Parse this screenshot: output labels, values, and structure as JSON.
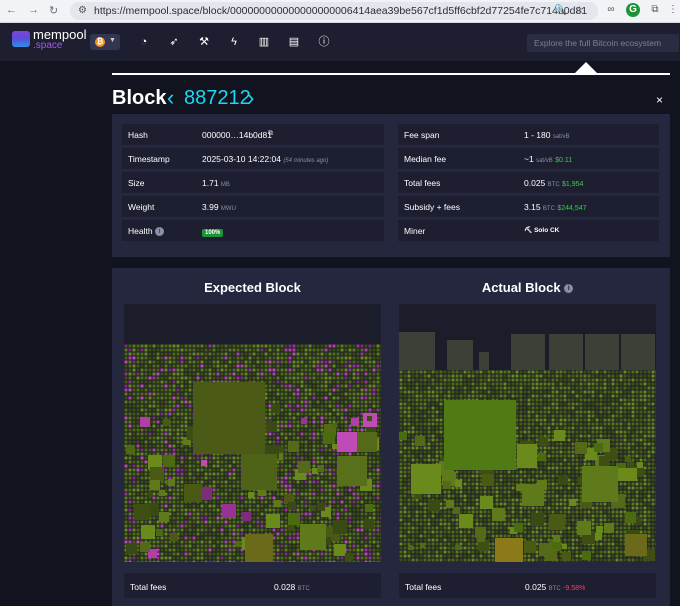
{
  "browser": {
    "url": "https://mempool.space/block/000000000000000000006414aea39be567cf1d5ff6cbf2d77254fe7c714b0d81"
  },
  "nav": {
    "logo_line1": "mempool",
    "logo_line2": ".space",
    "search_placeholder": "Explore the full Bitcoin ecosystem",
    "icons": [
      "dashboard-icon",
      "rocket-icon",
      "hammer-icon",
      "lightning-icon",
      "chart-icon",
      "docs-icon",
      "info-icon"
    ]
  },
  "page": {
    "title_word": "Block",
    "block_height": "887212",
    "close": "×"
  },
  "details_left": [
    {
      "label": "Hash",
      "value": "000000…14b0d81",
      "unit": ""
    },
    {
      "label": "Timestamp",
      "value": "2025-03-10 14:22:04",
      "unit": "(54 minutes ago)"
    },
    {
      "label": "Size",
      "value": "1.71",
      "unit": "MB"
    },
    {
      "label": "Weight",
      "value": "3.99",
      "unit": "MWU"
    },
    {
      "label": "Health",
      "value": "100%",
      "unit": ""
    }
  ],
  "details_right": [
    {
      "label": "Fee span",
      "value": "1 - 180",
      "unit": "sat/vB",
      "fiat": ""
    },
    {
      "label": "Median fee",
      "value": "~1",
      "unit": "sat/vB",
      "fiat": "$0.11"
    },
    {
      "label": "Total fees",
      "value": "0.025",
      "unit": "BTC",
      "fiat": "$1,954"
    },
    {
      "label": "Subsidy + fees",
      "value": "3.15",
      "unit": "BTC",
      "fiat": "$244,547"
    },
    {
      "label": "Miner",
      "value": "Solo CK",
      "unit": "",
      "fiat": ""
    }
  ],
  "expected": {
    "title": "Expected Block",
    "fees_label": "Total fees",
    "fees_value": "0.028",
    "fees_unit": "BTC"
  },
  "actual": {
    "title": "Actual Block",
    "fees_label": "Total fees",
    "fees_value": "0.025",
    "fees_unit": "BTC",
    "fees_delta": "-9.58%"
  },
  "colors": {
    "accent": "#1bd8f4",
    "positive": "#3bcc49",
    "negative": "#ff3d60",
    "background": "#11131f",
    "panel": "#24273e"
  }
}
